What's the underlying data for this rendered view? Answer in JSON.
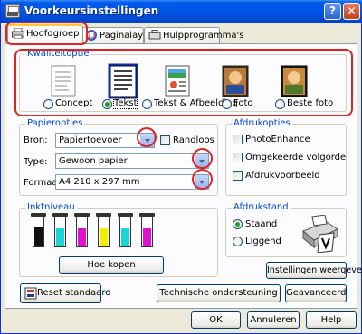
{
  "window": {
    "title": "Voorkeursinstellingen",
    "help_btn": "?",
    "close_btn": "✕"
  },
  "tabs": [
    {
      "label": "Hoofdgroep",
      "icon": "printer-icon"
    },
    {
      "label": "Paginalay-out",
      "icon": "layout-icon"
    },
    {
      "label": "Hulpprogramma's",
      "icon": "tools-icon"
    }
  ],
  "quality": {
    "legend": "Kwaliteitoptie",
    "options": [
      {
        "label": "Concept",
        "selected": false,
        "icon": "draft-document-icon"
      },
      {
        "label": "Tekst",
        "selected": true,
        "icon": "text-document-icon"
      },
      {
        "label": "Tekst & Afbeelding",
        "selected": false,
        "icon": "text-image-document-icon"
      },
      {
        "label": "Foto",
        "selected": false,
        "icon": "photo-icon"
      },
      {
        "label": "Beste foto",
        "selected": false,
        "icon": "best-photo-icon"
      }
    ]
  },
  "paper": {
    "legend": "Papieropties",
    "source_label": "Bron:",
    "source_value": "Papiertoevoer",
    "borderless_label": "Randloos",
    "type_label": "Type:",
    "type_value": "Gewoon papier",
    "format_label": "Formaat:",
    "format_value": "A4 210 x 297 mm"
  },
  "print_options": {
    "legend": "Afdrukopties",
    "items": [
      {
        "label": "PhotoEnhance",
        "checked": false
      },
      {
        "label": "Omgekeerde volgorde",
        "checked": false
      },
      {
        "label": "Afdrukvoorbeeld",
        "checked": false
      }
    ]
  },
  "ink": {
    "legend": "Inktniveau",
    "cartridges": [
      {
        "color": "#111111",
        "level": 0.62
      },
      {
        "color": "#19d6d6",
        "level": 0.55
      },
      {
        "color": "#e012d0",
        "level": 0.55
      },
      {
        "color": "#f0f000",
        "level": 0.55
      },
      {
        "color": "#19d6d6",
        "level": 0.55
      },
      {
        "color": "#e012d0",
        "level": 0.55
      }
    ],
    "how_to_order": "Hoe kopen"
  },
  "orientation": {
    "legend": "Afdrukstand",
    "options": [
      {
        "label": "Staand",
        "selected": true
      },
      {
        "label": "Liggend",
        "selected": false
      }
    ]
  },
  "buttons": {
    "show_settings": "Instellingen weergeven",
    "reset": "Reset standaard",
    "tech_support": "Technische ondersteuning",
    "advanced": "Geavanceerd",
    "ok": "OK",
    "cancel": "Annuleren",
    "help": "Help"
  }
}
